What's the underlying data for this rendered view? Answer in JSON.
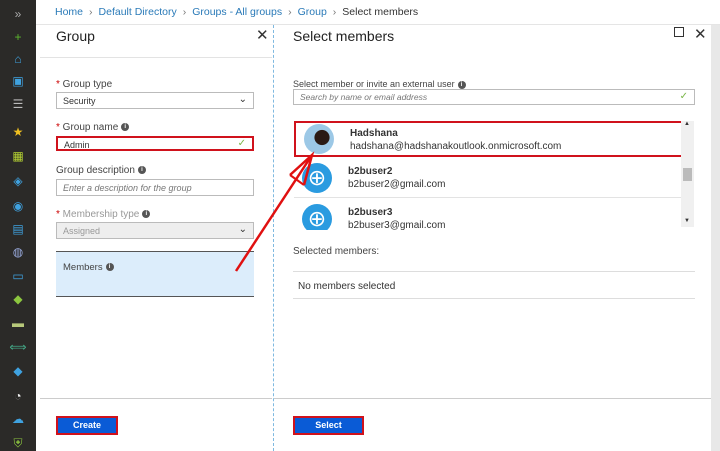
{
  "sidebar": {
    "items": [
      {
        "icon": "expand-icon",
        "glyph": "»",
        "color": "#aaa"
      },
      {
        "icon": "plus-icon",
        "glyph": "+",
        "color": "#5cb82e"
      },
      {
        "icon": "home-icon",
        "glyph": "⌂",
        "color": "#3fa2e0"
      },
      {
        "icon": "dashboard-icon",
        "glyph": "▣",
        "color": "#3fa2e0"
      },
      {
        "icon": "list-icon",
        "glyph": "☰",
        "color": "#bbb"
      },
      {
        "icon": "star-icon",
        "glyph": "★",
        "color": "#f0c020"
      },
      {
        "icon": "grid-icon",
        "glyph": "▦",
        "color": "#b7d433"
      },
      {
        "icon": "cube-icon",
        "glyph": "◈",
        "color": "#3fa2e0"
      },
      {
        "icon": "globe-icon",
        "glyph": "◉",
        "color": "#3fa2e0"
      },
      {
        "icon": "sql-icon",
        "glyph": "▤",
        "color": "#3fa2e0"
      },
      {
        "icon": "planet-icon",
        "glyph": "◍",
        "color": "#9ad"
      },
      {
        "icon": "monitor-icon",
        "glyph": "▭",
        "color": "#3fa2e0"
      },
      {
        "icon": "diamond-icon",
        "glyph": "◆",
        "color": "#8cc63f"
      },
      {
        "icon": "card-icon",
        "glyph": "▬",
        "color": "#b7c87a"
      },
      {
        "icon": "code-icon",
        "glyph": "⟺",
        "color": "#4a8"
      },
      {
        "icon": "info-diamond-icon",
        "glyph": "◆",
        "color": "#3fa2e0"
      },
      {
        "icon": "gauge-icon",
        "glyph": "◔",
        "color": "#eee"
      },
      {
        "icon": "cloud-icon",
        "glyph": "☁",
        "color": "#3fa2e0"
      },
      {
        "icon": "shield-icon",
        "glyph": "⛨",
        "color": "#8cc63f"
      }
    ]
  },
  "breadcrumb": [
    "Home",
    "Default Directory",
    "Groups - All groups",
    "Group",
    "Select members"
  ],
  "left": {
    "title": "Group",
    "group_type_label": "Group type",
    "group_type_value": "Security",
    "group_name_label": "Group name",
    "group_name_value": "Admin",
    "group_desc_label": "Group description",
    "group_desc_placeholder": "Enter a description for the group",
    "membership_label": "Membership type",
    "membership_value": "Assigned",
    "members_label": "Members",
    "create": "Create"
  },
  "right": {
    "title": "Select members",
    "search_label": "Select member or invite an external user",
    "search_placeholder": "Search by name or email address",
    "users": [
      {
        "name": "Hadshana",
        "email": "hadshana@hadshanakoutlook.onmicrosoft.com"
      },
      {
        "name": "b2buser2",
        "email": "b2buser2@gmail.com"
      },
      {
        "name": "b2buser3",
        "email": "b2buser3@gmail.com"
      }
    ],
    "selected_label": "Selected members:",
    "none_selected": "No members selected",
    "select": "Select"
  },
  "colors": {
    "accent": "#0a5bd6",
    "highlight": "#d0121c"
  }
}
